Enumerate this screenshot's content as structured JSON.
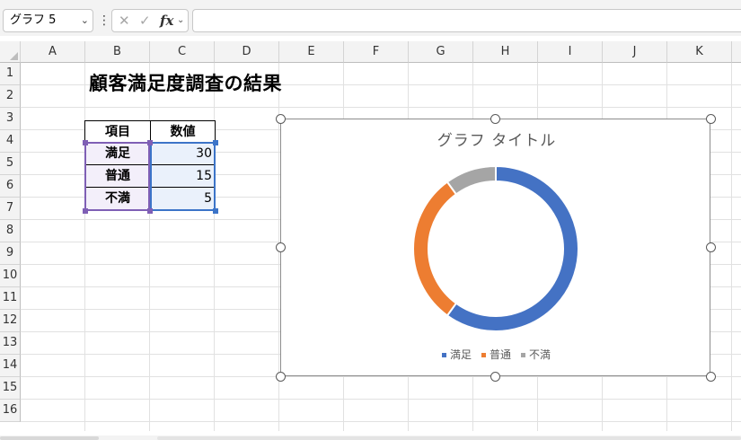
{
  "formula_bar": {
    "name_box": "グラフ 5",
    "fx": "fx",
    "cancel": "✕",
    "enter": "✓",
    "formula": ""
  },
  "grid": {
    "columns": [
      "A",
      "B",
      "C",
      "D",
      "E",
      "F",
      "G",
      "H",
      "I",
      "J",
      "K"
    ],
    "rows": [
      "1",
      "2",
      "3",
      "4",
      "5",
      "6",
      "7",
      "8",
      "9",
      "10",
      "11",
      "12",
      "13",
      "14",
      "15",
      "16"
    ]
  },
  "sheet": {
    "title": "顧客満足度調査の結果",
    "table": {
      "headers": [
        "項目",
        "数値"
      ],
      "rows": [
        {
          "item": "満足",
          "value": "30"
        },
        {
          "item": "普通",
          "value": "15"
        },
        {
          "item": "不満",
          "value": "5"
        }
      ]
    }
  },
  "chart_data": {
    "type": "pie",
    "variant": "doughnut",
    "title": "グラフ タイトル",
    "categories": [
      "満足",
      "普通",
      "不満"
    ],
    "values": [
      30,
      15,
      5
    ],
    "colors": [
      "#4472c4",
      "#ed7d31",
      "#a5a5a5"
    ],
    "legend": "bottom"
  }
}
